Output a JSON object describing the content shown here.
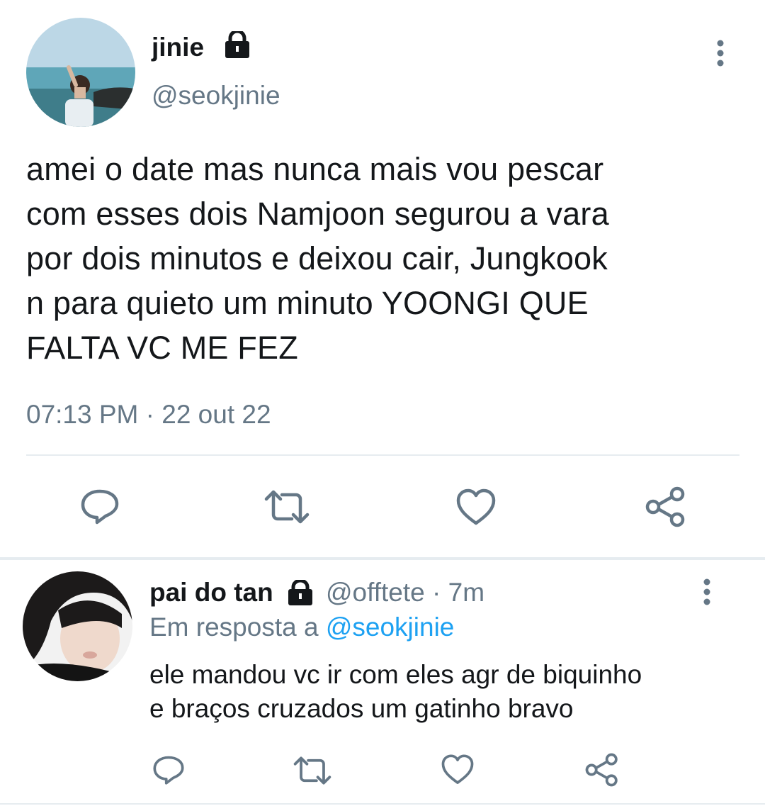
{
  "tweet": {
    "author_name": "jinie",
    "author_handle": "@seokjinie",
    "lock_icon": "lock-icon",
    "text_lines": [
      "amei o date mas nunca mais vou pescar",
      "com esses dois Namjoon segurou a vara",
      "por dois minutos e deixou cair, Jungkook",
      "n para quieto um minuto YOONGI QUE",
      "FALTA VC ME FEZ"
    ],
    "timestamp": "07:13 PM · 22 out 22"
  },
  "reply": {
    "author_name": "pai do tan",
    "author_handle": "@offtete",
    "time_ago": "· 7m",
    "in_reply_prefix": "Em resposta a",
    "in_reply_handle": "@seokjinie",
    "text_lines": [
      "ele mandou vc ir com eles agr de biquinho",
      "e braços cruzados um gatinho bravo"
    ]
  },
  "colors": {
    "text": "#14171a",
    "secondary": "#657786",
    "link": "#1da1f2",
    "divider": "#e6ecf0"
  },
  "icons": [
    "more-vertical-icon",
    "reply-icon",
    "retweet-icon",
    "like-icon",
    "share-icon",
    "lock-icon"
  ]
}
